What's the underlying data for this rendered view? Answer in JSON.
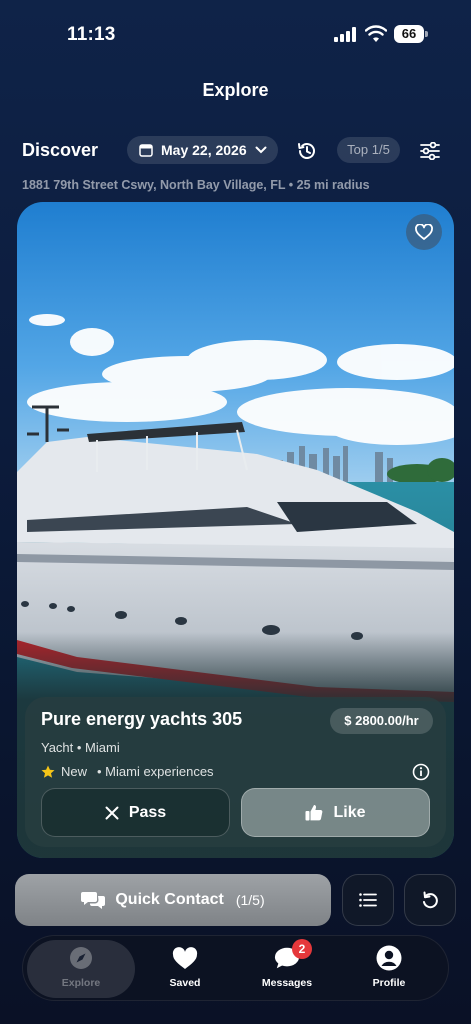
{
  "status_bar": {
    "time": "11:13",
    "battery": "66"
  },
  "header": {
    "title": "Explore"
  },
  "discover": {
    "label": "Discover",
    "date": "May 22, 2026",
    "top": "Top 1/5",
    "location": "1881 79th Street Cswy, North Bay Village, FL • 25 mi radius"
  },
  "card": {
    "name": "Pure energy yachts 305",
    "price": "$ 2800.00/hr",
    "type_line": "Yacht • Miami",
    "tag_new": "New",
    "tag_extra": "• Miami experiences",
    "pass_label": "Pass",
    "like_label": "Like"
  },
  "actions": {
    "quick_contact": "Quick Contact",
    "quick_count": "(1/5)"
  },
  "tabs": [
    {
      "label": "Explore",
      "icon": "compass-icon"
    },
    {
      "label": "Saved",
      "icon": "heart-icon"
    },
    {
      "label": "Messages",
      "icon": "chat-icon",
      "badge": "2"
    },
    {
      "label": "Profile",
      "icon": "person-icon"
    }
  ],
  "colors": {
    "accent_star": "#f5c518",
    "badge": "#e5383b",
    "hull_stripe": "#b3232a"
  }
}
